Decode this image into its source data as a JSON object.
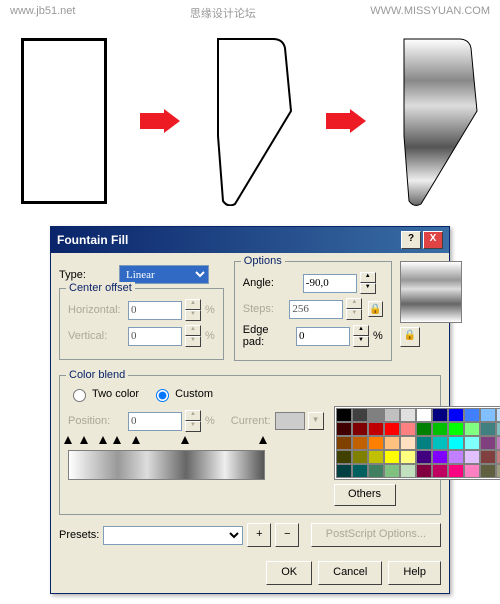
{
  "header": {
    "left": "www.jb51.net",
    "center": "思缘设计论坛",
    "right": "WWW.MISSYUAN.COM"
  },
  "dialog": {
    "title": "Fountain Fill",
    "controls": {
      "help": "?",
      "close": "X"
    },
    "type": {
      "label": "Type:",
      "value": "Linear"
    },
    "center_offset": {
      "legend": "Center offset",
      "horizontal": {
        "label": "Horizontal:",
        "value": "0",
        "unit": "%"
      },
      "vertical": {
        "label": "Vertical:",
        "value": "0",
        "unit": "%"
      }
    },
    "options": {
      "legend": "Options",
      "angle": {
        "label": "Angle:",
        "value": "-90,0"
      },
      "steps": {
        "label": "Steps:",
        "value": "256"
      },
      "edgepad": {
        "label": "Edge pad:",
        "value": "0",
        "unit": "%"
      }
    },
    "color_blend": {
      "legend": "Color blend",
      "two_color": "Two color",
      "custom": "Custom",
      "position": {
        "label": "Position:",
        "value": "0",
        "unit": "%"
      },
      "current": "Current:",
      "others": "Others"
    },
    "presets": {
      "label": "Presets:"
    },
    "postscript": "PostScript Options...",
    "buttons": {
      "ok": "OK",
      "cancel": "Cancel",
      "help": "Help"
    }
  },
  "palette_colors": [
    [
      "#000000",
      "#404040",
      "#808080",
      "#c0c0c0",
      "#e0e0e0",
      "#ffffff",
      "#000080",
      "#0000ff",
      "#4080ff",
      "#80c0ff",
      "#c0e0ff"
    ],
    [
      "#400000",
      "#800000",
      "#c00000",
      "#ff0000",
      "#ff8080",
      "#008000",
      "#00c000",
      "#00ff00",
      "#80ff80",
      "#408080",
      "#80c0c0"
    ],
    [
      "#804000",
      "#c06000",
      "#ff8000",
      "#ffc080",
      "#ffe0c0",
      "#008080",
      "#00c0c0",
      "#00ffff",
      "#80ffff",
      "#804080",
      "#c080c0"
    ],
    [
      "#404000",
      "#808000",
      "#c0c000",
      "#ffff00",
      "#ffff80",
      "#400080",
      "#8000ff",
      "#c080ff",
      "#e0c0ff",
      "#804040",
      "#c08080"
    ],
    [
      "#004040",
      "#006060",
      "#408060",
      "#80c080",
      "#c0e0c0",
      "#800040",
      "#c00060",
      "#ff0080",
      "#ff80c0",
      "#606040",
      "#a0a080"
    ]
  ],
  "gradient_stops": [
    0,
    8,
    18,
    25,
    35,
    60,
    100
  ]
}
